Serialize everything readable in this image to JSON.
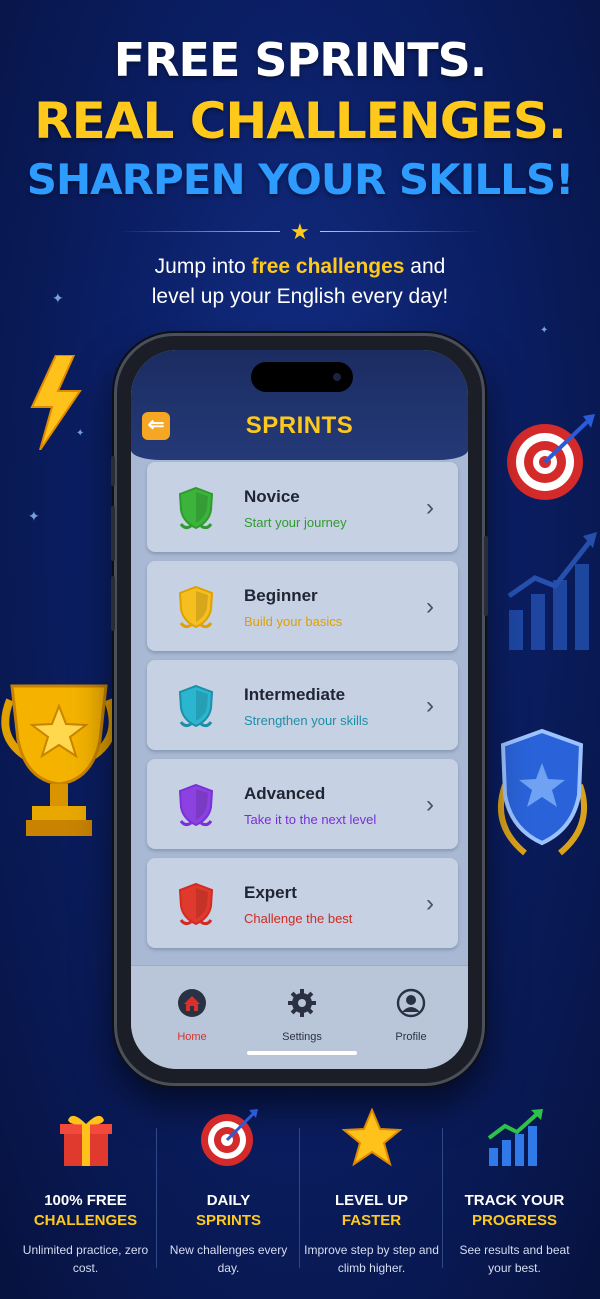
{
  "headline": {
    "line1": "FREE SPRINTS.",
    "line2": "REAL CHALLENGES.",
    "line3": "SHARPEN YOUR SKILLS!"
  },
  "subtitle": {
    "part1": "Jump into ",
    "highlight": "free challenges",
    "part2": " and",
    "line2": "level up your English every day!"
  },
  "app": {
    "title": "SPRINTS",
    "back_icon": "back-arrow-icon",
    "levels": [
      {
        "name": "Novice",
        "desc": "Start your journey",
        "color": "#2f9b2f",
        "shield": "#3cb43c"
      },
      {
        "name": "Beginner",
        "desc": "Build your basics",
        "color": "#e0a000",
        "shield": "#f5bf1f"
      },
      {
        "name": "Intermediate",
        "desc": "Strengthen your skills",
        "color": "#1c8fa8",
        "shield": "#2bb5cf"
      },
      {
        "name": "Advanced",
        "desc": "Take it to the next level",
        "color": "#7a2fd8",
        "shield": "#8c42e0"
      },
      {
        "name": "Expert",
        "desc": "Challenge the best",
        "color": "#d12b22",
        "shield": "#e03a2e"
      }
    ],
    "tabs": [
      {
        "label": "Home",
        "icon": "home-icon"
      },
      {
        "label": "Settings",
        "icon": "gear-icon"
      },
      {
        "label": "Profile",
        "icon": "user-icon"
      }
    ]
  },
  "features": [
    {
      "line1": "100% FREE",
      "line2": "CHALLENGES",
      "desc": "Unlimited practice, zero cost.",
      "icon": "gift-icon"
    },
    {
      "line1": "DAILY",
      "line2": "SPRINTS",
      "desc": "New challenges every day.",
      "icon": "target-icon"
    },
    {
      "line1": "LEVEL UP",
      "line2": "FASTER",
      "desc": "Improve step by step and climb higher.",
      "icon": "star-icon"
    },
    {
      "line1": "TRACK YOUR",
      "line2": "PROGRESS",
      "desc": "See results and beat your best.",
      "icon": "growth-chart-icon"
    }
  ],
  "colors": {
    "accent_yellow": "#ffc91c",
    "accent_blue": "#2e9bff",
    "active_tab": "#d6312f"
  }
}
